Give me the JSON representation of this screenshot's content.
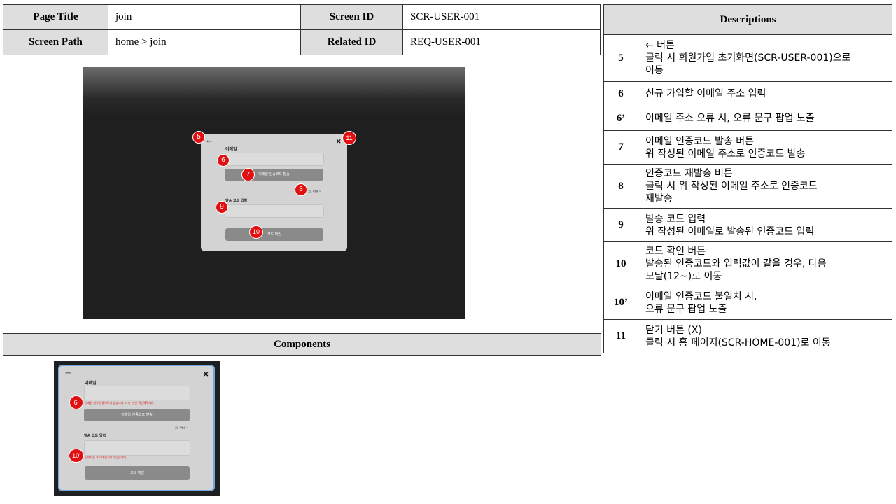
{
  "header": {
    "page_title_label": "Page Title",
    "page_title": "join",
    "screen_id_label": "Screen ID",
    "screen_id": "SCR-USER-001",
    "screen_path_label": "Screen Path",
    "screen_path": "home > join",
    "related_id_label": "Related ID",
    "related_id": "REQ-USER-001"
  },
  "mockup": {
    "back_icon": "←",
    "close_icon": "✕",
    "email_label": "이메일",
    "send_code_button": "이메일 인증코드 발송",
    "resend_link": "코드 재발송 >",
    "code_input_label": "발송 코드 입력",
    "confirm_button": "코드 확인"
  },
  "markers": [
    "5",
    "6",
    "7",
    "8",
    "9",
    "10",
    "11"
  ],
  "components": {
    "title": "Components",
    "email_label": "이메일",
    "email_error": "이메일 형식이 올바르지 않습니다. 다시 한 번 확인해주세요.",
    "send_code_button": "이메일 인증코드 발송",
    "resend_link": "코드 재발송 >",
    "code_input_label": "발송 코드 입력",
    "code_error": "입력하신 코드가 일치하지 않습니다.",
    "confirm_button": "코드 확인",
    "marker_6p": "6'",
    "marker_10p": "10'"
  },
  "descriptions": {
    "title": "Descriptions",
    "rows": [
      {
        "num": "5",
        "text": "← 버튼\n클릭 시 회원가입 초기화면(SCR-USER-001)으로\n이동"
      },
      {
        "num": "6",
        "text": "신규 가입할 이메일 주소 입력"
      },
      {
        "num": "6’",
        "text": "이메일 주소 오류 시, 오류 문구 팝업 노출"
      },
      {
        "num": "7",
        "text": "이메일 인증코드 발송 버튼\n위 작성된 이메일 주소로 인증코드 발송"
      },
      {
        "num": "8",
        "text": "인증코드 재발송 버튼\n클릭 시 위 작성된 이메일 주소로 인증코드\n재발송"
      },
      {
        "num": "9",
        "text": "발송 코드 입력\n위 작성된 이메일로 발송된 인증코드 입력"
      },
      {
        "num": "10",
        "text": "코드 확인 버튼\n발송된 인증코드와 입력값이 같을 경우, 다음\n모달(12~)로 이동"
      },
      {
        "num": "10’",
        "text": "이메일 인증코드 불일치 시,\n오류 문구 팝업 노출"
      },
      {
        "num": "11",
        "text": "닫기 버튼 (X)\n클릭 시 홈 페이지(SCR-HOME-001)로 이동"
      }
    ]
  },
  "colors": {
    "marker": "#e01010",
    "header_bg": "#dedede",
    "error": "#e02020",
    "modal_border": "#6fa8dc"
  }
}
